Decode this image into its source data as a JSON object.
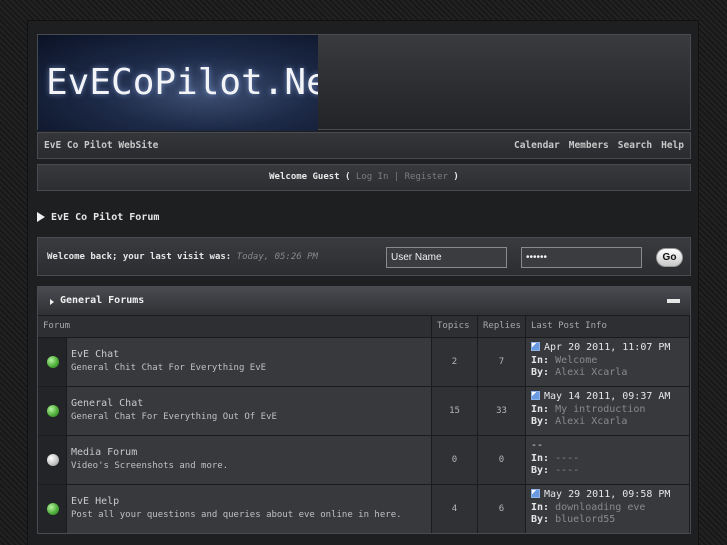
{
  "banner": {
    "logo_text": "EvECoPilot.Net"
  },
  "nav": {
    "site_name": "EvE Co Pilot WebSite",
    "links": [
      "Calendar",
      "Members",
      "Search",
      "Help"
    ]
  },
  "welcome": {
    "greeting": "Welcome Guest",
    "open_paren": "(",
    "login": "Log In",
    "separator": "|",
    "register": "Register",
    "close_paren": ")"
  },
  "breadcrumb": {
    "title": "EvE Co Pilot Forum"
  },
  "login_bar": {
    "message": "Welcome back; your last visit was:",
    "time": "Today, 05:26 PM",
    "username_value": "User Name",
    "password_value": "••••••",
    "go_label": "Go"
  },
  "category": {
    "title": "General Forums",
    "headers": {
      "forum": "Forum",
      "topics": "Topics",
      "replies": "Replies",
      "last_post": "Last Post Info"
    },
    "forums": [
      {
        "name": "EvE Chat",
        "description": "General Chit Chat For Everything EvE",
        "topics": "2",
        "replies": "7",
        "status": "new",
        "last_date": "Apr 20 2011, 11:07 PM",
        "in_label": "In:",
        "last_in": "Welcome",
        "by_label": "By:",
        "last_by": "Alexi Xcarla"
      },
      {
        "name": "General Chat",
        "description": "General Chat For Everything Out Of EvE",
        "topics": "15",
        "replies": "33",
        "status": "new",
        "last_date": "May 14 2011, 09:37 AM",
        "in_label": "In:",
        "last_in": "My introduction",
        "by_label": "By:",
        "last_by": "Alexi Xcarla"
      },
      {
        "name": "Media Forum",
        "description": "Video's Screenshots and more.",
        "topics": "0",
        "replies": "0",
        "status": "none",
        "last_date": "--",
        "in_label": "In:",
        "last_in": "----",
        "by_label": "By:",
        "last_by": "----"
      },
      {
        "name": "EvE Help",
        "description": "Post all your questions and queries about eve online in here.",
        "topics": "4",
        "replies": "6",
        "status": "new",
        "last_date": "May 29 2011, 09:58 PM",
        "in_label": "In:",
        "last_in": "downloading eve",
        "by_label": "By:",
        "last_by": "bluelord55"
      }
    ]
  },
  "colors": {
    "status_new": "#4fb03a",
    "status_none": "#c6c6c6",
    "link_muted": "#8a8a8a"
  }
}
